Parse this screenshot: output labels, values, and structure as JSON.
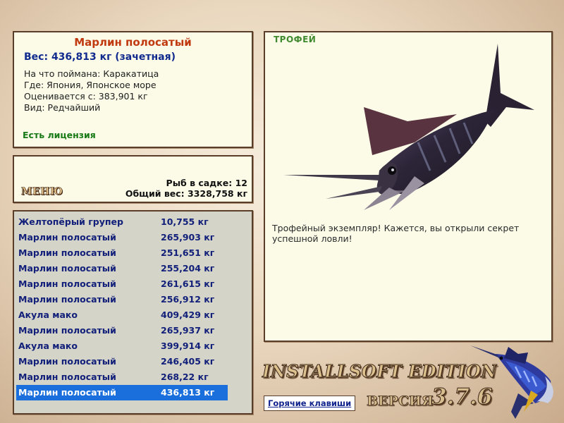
{
  "info": {
    "fish_name": "Марлин полосатый",
    "weight": "Вес: 436,813 кг (зачетная)",
    "bait": "На что поймана: Каракатица",
    "location": "Где: Япония, Японское море",
    "valued_from": "Оценивается с: 383,901 кг",
    "rarity": "Вид: Редчайший",
    "license": "Есть лицензия"
  },
  "keepnet": {
    "menu_label": "МЕНЮ",
    "fish_count": "Рыб в садке: 12",
    "total_weight": "Общий вес: 3328,758 кг"
  },
  "catch_list": [
    {
      "name": "Желтопёрый групер",
      "weight": "10,755 кг"
    },
    {
      "name": "Марлин полосатый",
      "weight": "265,903 кг"
    },
    {
      "name": "Марлин полосатый",
      "weight": "251,651 кг"
    },
    {
      "name": "Марлин полосатый",
      "weight": "255,204 кг"
    },
    {
      "name": "Марлин полосатый",
      "weight": "261,615 кг"
    },
    {
      "name": "Марлин полосатый",
      "weight": "256,912 кг"
    },
    {
      "name": "Акула мако",
      "weight": "409,429 кг"
    },
    {
      "name": "Марлин полосатый",
      "weight": "265,937 кг"
    },
    {
      "name": "Акула мако",
      "weight": "399,914 кг"
    },
    {
      "name": "Марлин полосатый",
      "weight": "246,405 кг"
    },
    {
      "name": "Марлин полосатый",
      "weight": "268,22 кг"
    },
    {
      "name": "Марлин полосатый",
      "weight": "436,813 кг"
    }
  ],
  "selected_index": 11,
  "trophy": {
    "title": "ТРОФЕЙ",
    "description": "Трофейный экземпляр! Кажется, вы открыли секрет успешной ловли!",
    "image_icon": "marlin-trophy-icon"
  },
  "hotkeys_label": "Горячие клавиши",
  "branding": {
    "edition": "INSTALLSOFT EDITION",
    "version_label": "ВЕРСИЯ",
    "version_number": "3.7.6",
    "logo_icon": "marlin-logo-icon"
  },
  "colors": {
    "panel_bg": "#fbfbe8",
    "panel_border": "#5b3e2a",
    "fish_name": "#c0390f",
    "text_blue": "#112a8e",
    "license_green": "#177a16",
    "selection": "#1a6fdc",
    "list_bg": "#d4d4c8"
  }
}
